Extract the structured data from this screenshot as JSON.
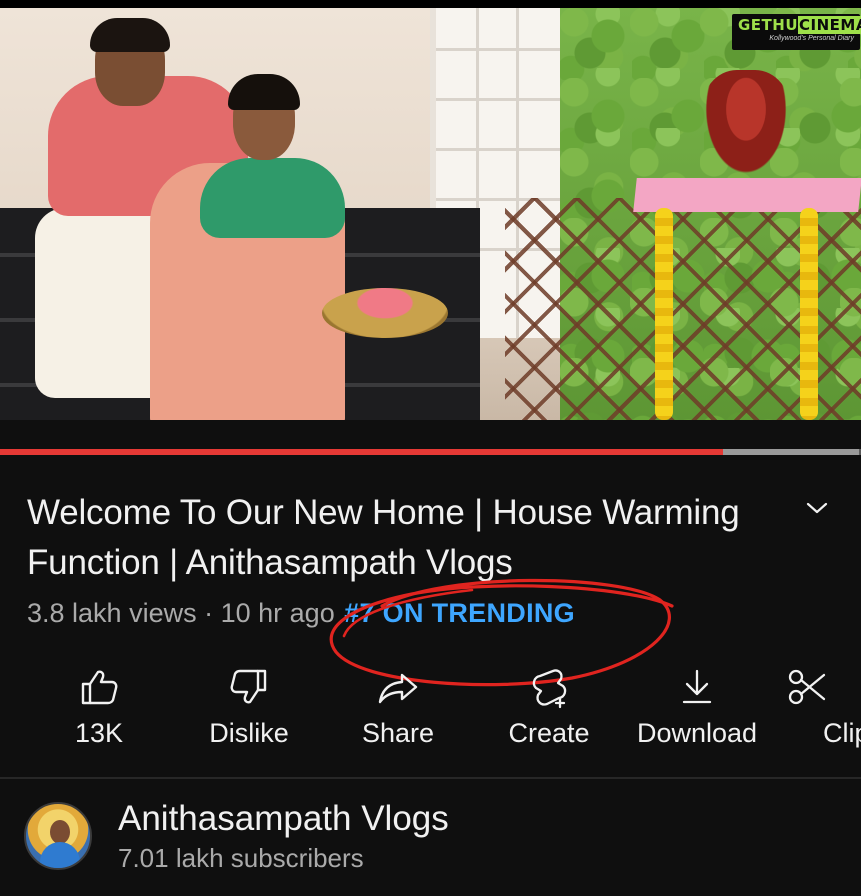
{
  "watermark": {
    "brand": "GETHUCINEMA",
    "brand_part1": "GETHU",
    "brand_part2": "CINEMA",
    "tagline": "Kollywood's Personal Diary"
  },
  "player": {
    "progress_fraction": 0.84,
    "buffer_fraction": 0.998,
    "colors": {
      "progress": "#e53935",
      "buffer": "#9a9a9a",
      "track": "#5b5b5b"
    }
  },
  "video": {
    "title": "Welcome To Our New Home | House Warming Function | Anithasampath Vlogs",
    "views": "3.8 lakh views",
    "separator": "·",
    "age": "10 hr ago",
    "trending": "#7 ON TRENDING",
    "trending_color": "#3ea6ff"
  },
  "actions": [
    {
      "key": "like",
      "label": "13K",
      "icon": "thumbs-up-icon"
    },
    {
      "key": "dislike",
      "label": "Dislike",
      "icon": "thumbs-down-icon"
    },
    {
      "key": "share",
      "label": "Share",
      "icon": "share-arrow-icon"
    },
    {
      "key": "create",
      "label": "Create",
      "icon": "create-shorts-icon"
    },
    {
      "key": "download",
      "label": "Download",
      "icon": "download-icon"
    },
    {
      "key": "clip",
      "label": "Clip",
      "icon": "scissors-icon"
    }
  ],
  "channel": {
    "name": "Anithasampath Vlogs",
    "subscribers": "7.01 lakh subscribers"
  },
  "theme": {
    "background": "#0f0f0f",
    "text_primary": "#f1f1f1",
    "text_secondary": "#aaaaaa",
    "annotation": "#e0241f"
  }
}
